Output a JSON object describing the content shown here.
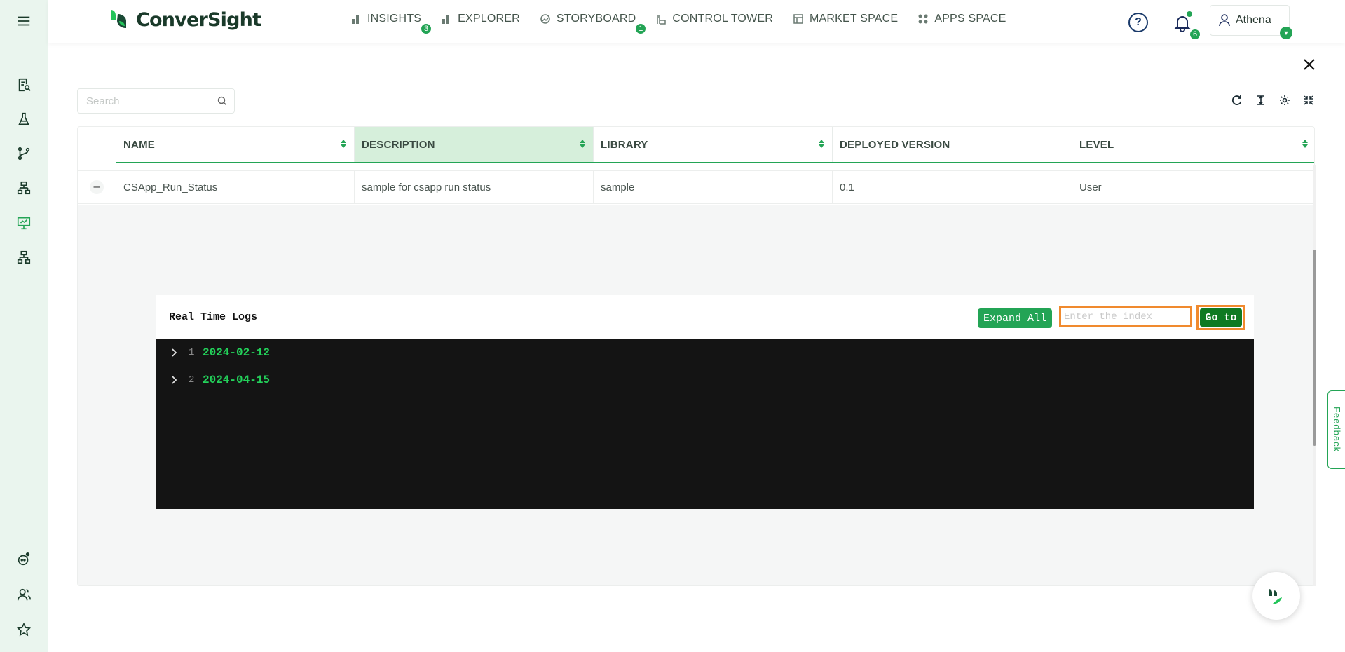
{
  "app": {
    "name": "ConverSight"
  },
  "nav": [
    {
      "label": "INSIGHTS",
      "badge": "3",
      "icon": "bar-chart-icon"
    },
    {
      "label": "EXPLORER",
      "badge": "",
      "icon": "bar-chart-icon"
    },
    {
      "label": "STORYBOARD",
      "badge": "1",
      "icon": "storyboard-icon"
    },
    {
      "label": "CONTROL TOWER",
      "badge": "",
      "icon": "tower-icon"
    },
    {
      "label": "MARKET SPACE",
      "badge": "",
      "icon": "market-icon"
    },
    {
      "label": "APPS SPACE",
      "badge": "",
      "icon": "grid-icon"
    }
  ],
  "header": {
    "notifications_count": "6",
    "user_name": "Athena"
  },
  "search": {
    "placeholder": "Search"
  },
  "table": {
    "columns": [
      "NAME",
      "DESCRIPTION",
      "LIBRARY",
      "DEPLOYED VERSION",
      "LEVEL"
    ],
    "sorted_column": "DESCRIPTION",
    "rows": [
      {
        "name": "CSApp_Run_Status",
        "description": "sample for csapp run status",
        "library": "sample",
        "deployed_version": "0.1",
        "level": "User"
      }
    ]
  },
  "logs": {
    "title": "Real Time Logs",
    "expand_all_label": "Expand All",
    "index_placeholder": "Enter the index",
    "goto_label": "Go to",
    "entries": [
      {
        "index": "1",
        "date": "2024-02-12"
      },
      {
        "index": "2",
        "date": "2024-04-15"
      }
    ]
  },
  "feedback_label": "Feedback",
  "colors": {
    "accent": "#23a455",
    "highlight": "#f08a2e",
    "dark_green": "#0f7a22",
    "console_bg": "#141414"
  }
}
